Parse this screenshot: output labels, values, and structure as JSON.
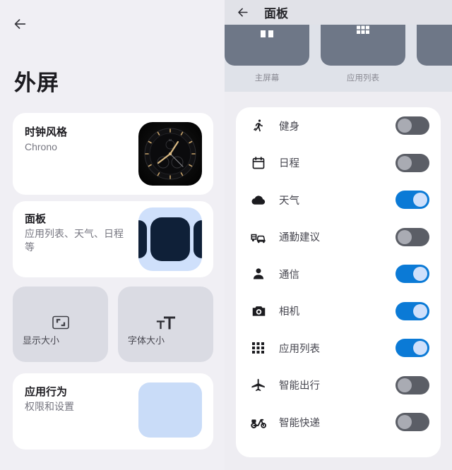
{
  "left": {
    "back_icon": "arrow-left-icon",
    "title": "外屏",
    "cards": [
      {
        "id": "clock",
        "title": "时钟风格",
        "subtitle": "Chrono",
        "thumb": "watch-face-chrono-thumbnail"
      },
      {
        "id": "panel",
        "title": "面板",
        "subtitle": "应用列表、天气、日程等",
        "thumb": "panel-carousel-thumbnail"
      },
      {
        "id": "behavior",
        "title": "应用行为",
        "subtitle": "权限和设置",
        "thumb": "app-behavior-thumbnail"
      }
    ],
    "tiles": [
      {
        "id": "display-size",
        "label": "显示大小",
        "icon": "display-size-icon"
      },
      {
        "id": "font-size",
        "label": "字体大小",
        "icon": "font-size-icon"
      }
    ]
  },
  "right": {
    "back_icon": "arrow-left-icon",
    "title": "面板",
    "carousel": [
      {
        "label": "主屏幕",
        "glyph": "home-screen-icon"
      },
      {
        "label": "应用列表",
        "glyph": "app-grid-icon"
      },
      {
        "label": "",
        "glyph": ""
      }
    ],
    "rows": [
      {
        "label": "健身",
        "icon": "running-icon",
        "on": false
      },
      {
        "label": "日程",
        "icon": "calendar-icon",
        "on": false
      },
      {
        "label": "天气",
        "icon": "cloud-icon",
        "on": true
      },
      {
        "label": "通勤建议",
        "icon": "commute-icon",
        "on": false
      },
      {
        "label": "通信",
        "icon": "person-icon",
        "on": true
      },
      {
        "label": "相机",
        "icon": "camera-icon",
        "on": true
      },
      {
        "label": "应用列表",
        "icon": "app-grid-icon",
        "on": true
      },
      {
        "label": "智能出行",
        "icon": "airplane-icon",
        "on": false
      },
      {
        "label": "智能快递",
        "icon": "scooter-icon",
        "on": false
      }
    ]
  },
  "colors": {
    "left_bg": "#f0eff4",
    "right_bg": "#eeedf2",
    "header_bg": "#e1e2e8",
    "carousel_bg": "#dfe2e9",
    "card_bg": "#ffffff",
    "tile_bg": "#dadbe3",
    "toggle_on": "#0b7ad6",
    "toggle_off": "#5b5e66",
    "accent_light_blue": "#c9dcf8",
    "text_primary": "#1c1b20",
    "text_secondary": "#767680"
  }
}
